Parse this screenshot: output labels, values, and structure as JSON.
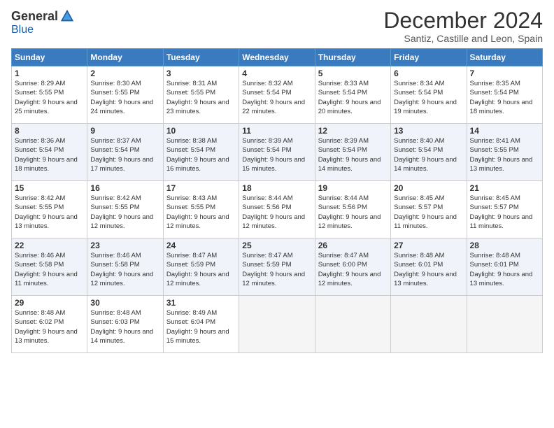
{
  "header": {
    "logo_general": "General",
    "logo_blue": "Blue",
    "month_title": "December 2024",
    "location": "Santiz, Castille and Leon, Spain"
  },
  "weekdays": [
    "Sunday",
    "Monday",
    "Tuesday",
    "Wednesday",
    "Thursday",
    "Friday",
    "Saturday"
  ],
  "weeks": [
    [
      {
        "day": "1",
        "sunrise": "8:29 AM",
        "sunset": "5:55 PM",
        "daylight": "9 hours and 25 minutes."
      },
      {
        "day": "2",
        "sunrise": "8:30 AM",
        "sunset": "5:55 PM",
        "daylight": "9 hours and 24 minutes."
      },
      {
        "day": "3",
        "sunrise": "8:31 AM",
        "sunset": "5:55 PM",
        "daylight": "9 hours and 23 minutes."
      },
      {
        "day": "4",
        "sunrise": "8:32 AM",
        "sunset": "5:54 PM",
        "daylight": "9 hours and 22 minutes."
      },
      {
        "day": "5",
        "sunrise": "8:33 AM",
        "sunset": "5:54 PM",
        "daylight": "9 hours and 20 minutes."
      },
      {
        "day": "6",
        "sunrise": "8:34 AM",
        "sunset": "5:54 PM",
        "daylight": "9 hours and 19 minutes."
      },
      {
        "day": "7",
        "sunrise": "8:35 AM",
        "sunset": "5:54 PM",
        "daylight": "9 hours and 18 minutes."
      }
    ],
    [
      {
        "day": "8",
        "sunrise": "8:36 AM",
        "sunset": "5:54 PM",
        "daylight": "9 hours and 18 minutes."
      },
      {
        "day": "9",
        "sunrise": "8:37 AM",
        "sunset": "5:54 PM",
        "daylight": "9 hours and 17 minutes."
      },
      {
        "day": "10",
        "sunrise": "8:38 AM",
        "sunset": "5:54 PM",
        "daylight": "9 hours and 16 minutes."
      },
      {
        "day": "11",
        "sunrise": "8:39 AM",
        "sunset": "5:54 PM",
        "daylight": "9 hours and 15 minutes."
      },
      {
        "day": "12",
        "sunrise": "8:39 AM",
        "sunset": "5:54 PM",
        "daylight": "9 hours and 14 minutes."
      },
      {
        "day": "13",
        "sunrise": "8:40 AM",
        "sunset": "5:54 PM",
        "daylight": "9 hours and 14 minutes."
      },
      {
        "day": "14",
        "sunrise": "8:41 AM",
        "sunset": "5:55 PM",
        "daylight": "9 hours and 13 minutes."
      }
    ],
    [
      {
        "day": "15",
        "sunrise": "8:42 AM",
        "sunset": "5:55 PM",
        "daylight": "9 hours and 13 minutes."
      },
      {
        "day": "16",
        "sunrise": "8:42 AM",
        "sunset": "5:55 PM",
        "daylight": "9 hours and 12 minutes."
      },
      {
        "day": "17",
        "sunrise": "8:43 AM",
        "sunset": "5:55 PM",
        "daylight": "9 hours and 12 minutes."
      },
      {
        "day": "18",
        "sunrise": "8:44 AM",
        "sunset": "5:56 PM",
        "daylight": "9 hours and 12 minutes."
      },
      {
        "day": "19",
        "sunrise": "8:44 AM",
        "sunset": "5:56 PM",
        "daylight": "9 hours and 12 minutes."
      },
      {
        "day": "20",
        "sunrise": "8:45 AM",
        "sunset": "5:57 PM",
        "daylight": "9 hours and 11 minutes."
      },
      {
        "day": "21",
        "sunrise": "8:45 AM",
        "sunset": "5:57 PM",
        "daylight": "9 hours and 11 minutes."
      }
    ],
    [
      {
        "day": "22",
        "sunrise": "8:46 AM",
        "sunset": "5:58 PM",
        "daylight": "9 hours and 11 minutes."
      },
      {
        "day": "23",
        "sunrise": "8:46 AM",
        "sunset": "5:58 PM",
        "daylight": "9 hours and 12 minutes."
      },
      {
        "day": "24",
        "sunrise": "8:47 AM",
        "sunset": "5:59 PM",
        "daylight": "9 hours and 12 minutes."
      },
      {
        "day": "25",
        "sunrise": "8:47 AM",
        "sunset": "5:59 PM",
        "daylight": "9 hours and 12 minutes."
      },
      {
        "day": "26",
        "sunrise": "8:47 AM",
        "sunset": "6:00 PM",
        "daylight": "9 hours and 12 minutes."
      },
      {
        "day": "27",
        "sunrise": "8:48 AM",
        "sunset": "6:01 PM",
        "daylight": "9 hours and 13 minutes."
      },
      {
        "day": "28",
        "sunrise": "8:48 AM",
        "sunset": "6:01 PM",
        "daylight": "9 hours and 13 minutes."
      }
    ],
    [
      {
        "day": "29",
        "sunrise": "8:48 AM",
        "sunset": "6:02 PM",
        "daylight": "9 hours and 13 minutes."
      },
      {
        "day": "30",
        "sunrise": "8:48 AM",
        "sunset": "6:03 PM",
        "daylight": "9 hours and 14 minutes."
      },
      {
        "day": "31",
        "sunrise": "8:49 AM",
        "sunset": "6:04 PM",
        "daylight": "9 hours and 15 minutes."
      },
      null,
      null,
      null,
      null
    ]
  ]
}
